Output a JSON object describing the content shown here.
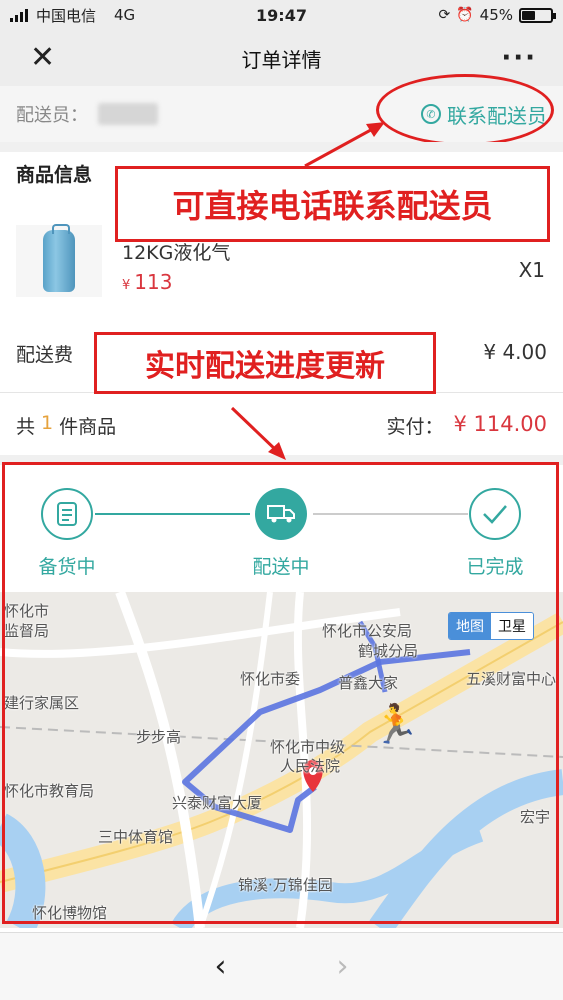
{
  "status_bar": {
    "carrier": "中国电信",
    "network": "4G",
    "time": "19:47",
    "battery": "45%",
    "battery_level": 0.45
  },
  "nav": {
    "title": "订单详情",
    "close_icon": "close-icon",
    "more_icon": "more-icon"
  },
  "courier": {
    "label": "配送员：",
    "contact_label": "联系配送员"
  },
  "goods": {
    "section_title": "商品信息",
    "item": {
      "name": "12KG液化气",
      "currency": "¥",
      "price": "113",
      "qty": "X1"
    }
  },
  "fee": {
    "label": "配送费",
    "value": "¥ 4.00"
  },
  "summary": {
    "prefix": "共",
    "count": "1",
    "suffix": "件商品",
    "paid_label": "实付：",
    "paid_value": "¥ 114.00"
  },
  "progress": {
    "steps": [
      {
        "label": "备货中",
        "state": "done"
      },
      {
        "label": "配送中",
        "state": "current"
      },
      {
        "label": "已完成",
        "state": "pending"
      }
    ]
  },
  "map": {
    "toggle": {
      "map": "地图",
      "satellite": "卫星"
    },
    "labels": [
      "怀化市",
      "监督局",
      "怀化市公安局",
      "鹤城分局",
      "怀化市委",
      "五溪财富中心",
      "建行家属区",
      "步步高",
      "怀化市中级",
      "人民法院",
      "怀化市教育局",
      "兴泰财富大厦",
      "三中体育馆",
      "宏宇",
      "锦溪·万锦佳园",
      "怀化博物馆",
      "普鑫大家"
    ]
  },
  "annotations": {
    "call_tip": "可直接电话联系配送员",
    "progress_tip": "实时配送进度更新"
  },
  "bottom_nav": {
    "back": "‹",
    "forward": "›"
  },
  "colors": {
    "accent": "#33a8a0",
    "price": "#d9363e",
    "annotation": "#e02020",
    "route": "#5b74e0"
  }
}
